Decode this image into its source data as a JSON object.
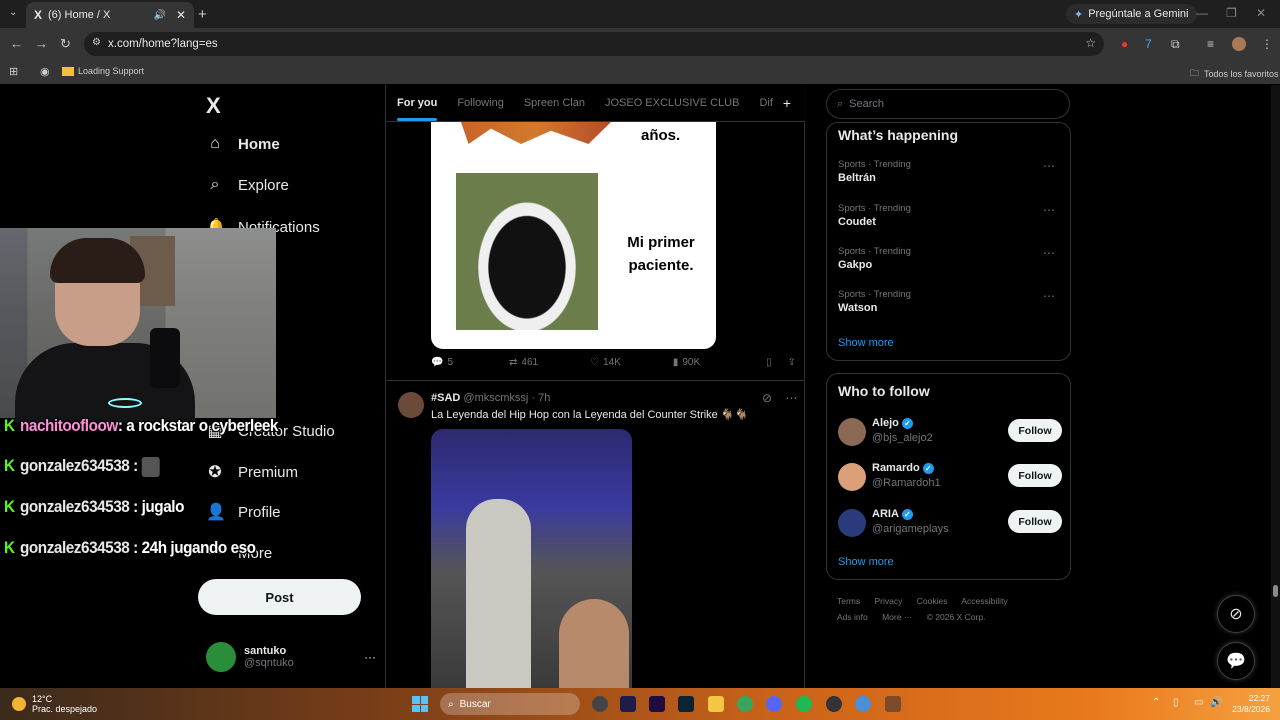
{
  "browser": {
    "tab_title": "(6) Home / X",
    "tab_logo": "X",
    "new_tab": "+",
    "gemini_label": "Pregúntale a Gemini",
    "url": "x.com/home?lang=es",
    "bookmark_item": "Loading Support",
    "bookmarks_folder": "Todos los favoritos"
  },
  "sidebar": {
    "logo": "X",
    "items": [
      {
        "label": "Home",
        "icon": "home-icon"
      },
      {
        "label": "Explore",
        "icon": "search-icon"
      },
      {
        "label": "Notifications",
        "icon": "bell-icon"
      },
      {
        "label": "Creator Studio",
        "icon": "creator-studio-icon"
      },
      {
        "label": "Premium",
        "icon": "premium-icon"
      },
      {
        "label": "Profile",
        "icon": "person-icon"
      },
      {
        "label": "More",
        "icon": "more-circle-icon"
      }
    ],
    "post_label": "Post",
    "account": {
      "name": "santuko",
      "handle": "@sqntuko",
      "more": "···"
    }
  },
  "feed": {
    "tabs": [
      "For you",
      "Following",
      "Spreen Clan",
      "JOSEO EXCLUSIVE CLUB",
      "Dif"
    ],
    "add_tab": "+",
    "meme": {
      "top_text": "años.",
      "caption": "Mi primer paciente."
    },
    "tweet1_stats": {
      "replies": "5",
      "reposts": "461",
      "likes": "14K",
      "views": "90K"
    },
    "tweet2": {
      "name": "#SAD",
      "handle": "@mkscmkssj",
      "time": "· 7h",
      "text": "La Leyenda del Hip Hop con la Leyenda del Counter Strike 🐐🐐"
    }
  },
  "right": {
    "search_placeholder": "Search",
    "happening_title": "What’s happening",
    "trends": [
      {
        "meta": "Sports · Trending",
        "name": "Beltrán"
      },
      {
        "meta": "Sports · Trending",
        "name": "Coudet"
      },
      {
        "meta": "Sports · Trending",
        "name": "Gakpo"
      },
      {
        "meta": "Sports · Trending",
        "name": "Watson"
      }
    ],
    "show_more": "Show more",
    "wtf_title": "Who to follow",
    "follow_suggestions": [
      {
        "name": "Alejo",
        "handle": "@bjs_alejo2",
        "avatar_color": "#8a6a55"
      },
      {
        "name": "Ramardo",
        "handle": "@Ramardoh1",
        "avatar_color": "#d9a07a"
      },
      {
        "name": "ARIA",
        "handle": "@arigameplays",
        "avatar_color": "#2a3a7a"
      }
    ],
    "follow_label": "Follow",
    "footer_links": [
      "Terms",
      "Privacy",
      "Cookies",
      "Accessibility",
      "Ads info",
      "More ···",
      "© 2026 X Corp."
    ]
  },
  "overlay_chat": [
    {
      "user": "nachitoofloow",
      "msg": ": a rockstar o cyberleek"
    },
    {
      "user": "gonzalez634538",
      "msg": " : "
    },
    {
      "user": "gonzalez634538",
      "msg": " : jugalo"
    },
    {
      "user": "gonzalez634538",
      "msg": " : 24h jugando eso"
    }
  ],
  "taskbar": {
    "temp": "12°C",
    "weather_desc": "Prac. despejado",
    "search_label": "Buscar",
    "time": "22:27",
    "date": "23/8/2026"
  },
  "colors": {
    "accent": "#1d9bf0",
    "background": "#000000",
    "kick_green": "#53fc18"
  }
}
